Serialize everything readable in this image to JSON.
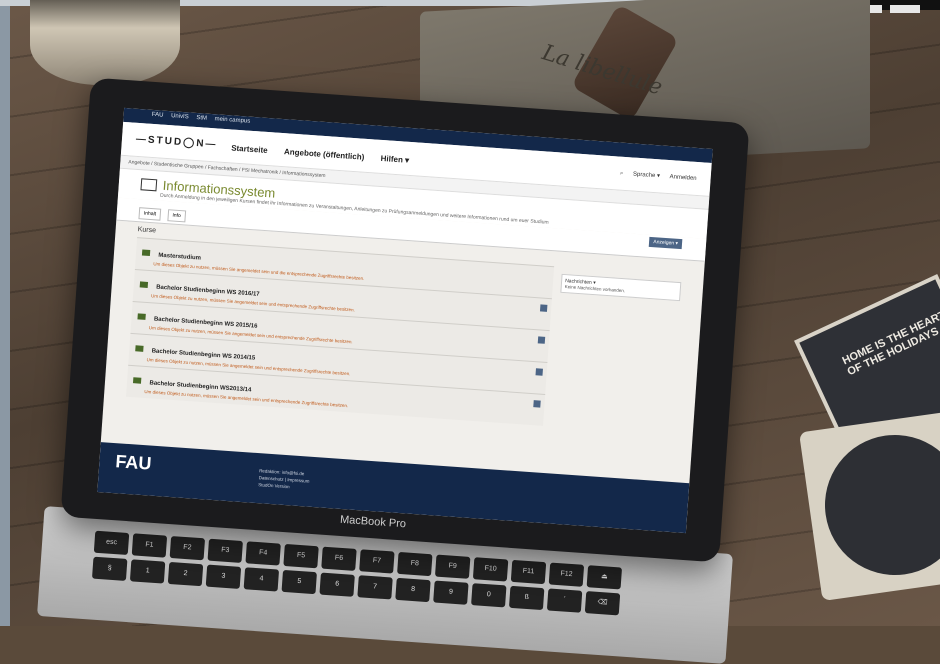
{
  "photo": {
    "jar_label": "",
    "pouch_text": "La libellule",
    "coaster_text": "HOME IS THE HEART OF THE HOLIDAYS",
    "laptop_brand": "MacBook Pro"
  },
  "screen": {
    "topnav": [
      "FAU",
      "UnivIS",
      "StM",
      "mein campus"
    ],
    "logo": "—STUD◯N—",
    "mainnav": [
      "Startseite",
      "Angebote (öffentlich)",
      "Hilfen ▾"
    ],
    "header_right": [
      "⌕",
      "Sprache ▾",
      "Anmelden"
    ],
    "breadcrumb": "Angebote / Studentische Gruppen / Fachschaften / FSI Mechatronik / Informationssystem",
    "page_title": "Informationssystem",
    "page_desc": "Durch Anmeldung in den jeweiligen Kursen findet ihr Informationen zu Veranstaltungen, Anleitungen zu Prüfungsanmeldungen und weitere Informationen rund um euer Studium",
    "tabs": [
      "Inhalt",
      "Info"
    ],
    "action_button": "Anzeigen ▾",
    "section_title": "Kurse",
    "courses": [
      {
        "title": "Masterstudium",
        "message": "Um dieses Objekt zu nutzen, müssen Sie angemeldet sein und die entsprechende Zugriffsrechte besitzen."
      },
      {
        "title": "Bachelor Studienbeginn WS 2016/17",
        "message": "Um dieses Objekt zu nutzen, müssen Sie angemeldet sein und entsprechende Zugriffsrechte besitzen."
      },
      {
        "title": "Bachelor Studienbeginn WS 2015/16",
        "message": "Um dieses Objekt zu nutzen, müssen Sie angemeldet sein und entsprechende Zugriffsrechte besitzen."
      },
      {
        "title": "Bachelor Studienbeginn WS 2014/15",
        "message": "Um dieses Objekt zu nutzen, müssen Sie angemeldet sein und entsprechende Zugriffsrechte besitzen."
      },
      {
        "title": "Bachelor Studienbeginn WS2013/14",
        "message": "Um dieses Objekt zu nutzen, müssen Sie angemeldet sein und entsprechende Zugriffsrechte besitzen."
      }
    ],
    "sidebar": {
      "heading": "Nachrichten ▾",
      "text": "Keine Nachrichten vorhanden."
    },
    "footer": {
      "logo": "FAU",
      "lines": [
        "Redaktion: info@fsi.de",
        "Datenschutz | Impressum",
        "StudOn Version"
      ]
    }
  },
  "keyboard": [
    "esc",
    "F1",
    "F2",
    "F3",
    "F4",
    "F5",
    "F6",
    "F7",
    "F8",
    "F9",
    "F10",
    "F11",
    "F12",
    "⏏",
    "§",
    "1",
    "2",
    "3",
    "4",
    "5",
    "6",
    "7",
    "8",
    "9",
    "0",
    "ß",
    "´",
    "⌫"
  ]
}
